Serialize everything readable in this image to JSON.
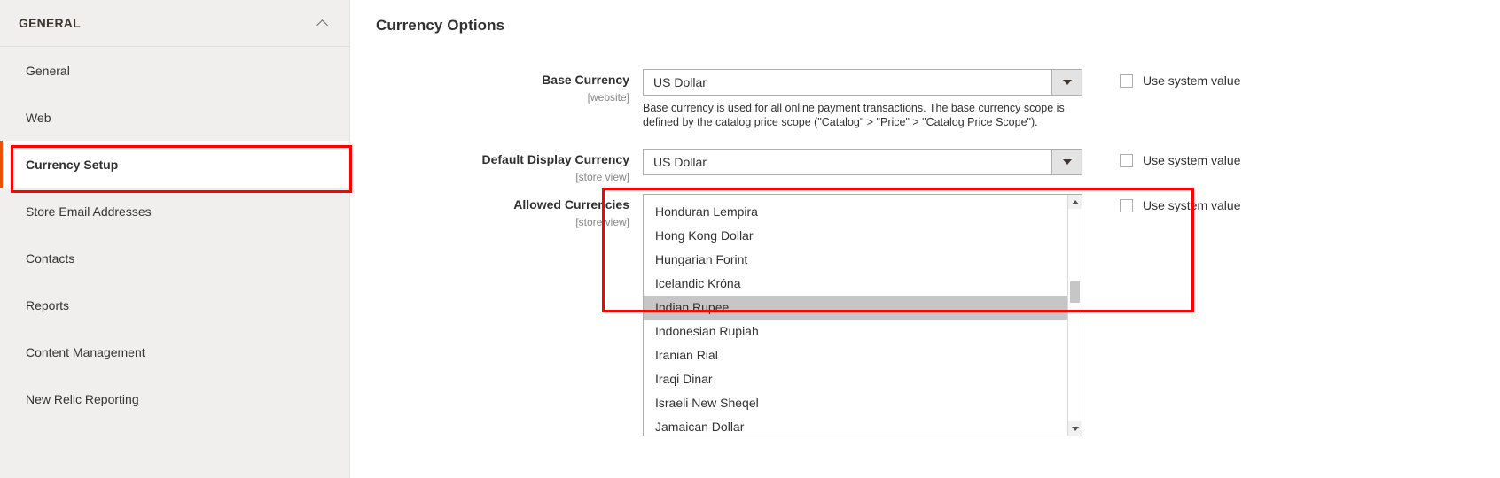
{
  "sidebar": {
    "header": {
      "title": "GENERAL",
      "collapse_icon": "chevron-up-icon"
    },
    "items": [
      {
        "label": "General",
        "active": false
      },
      {
        "label": "Web",
        "active": false
      },
      {
        "label": "Currency Setup",
        "active": true
      },
      {
        "label": "Store Email Addresses",
        "active": false
      },
      {
        "label": "Contacts",
        "active": false
      },
      {
        "label": "Reports",
        "active": false
      },
      {
        "label": "Content Management",
        "active": false
      },
      {
        "label": "New Relic Reporting",
        "active": false
      }
    ]
  },
  "main": {
    "page_title": "Currency Options",
    "fields": {
      "base_currency": {
        "label": "Base Currency",
        "scope": "[website]",
        "value": "US Dollar",
        "note": "Base currency is used for all online payment transactions. The base currency scope is defined by the catalog price scope (\"Catalog\" > \"Price\" > \"Catalog Price Scope\").",
        "use_system_value_label": "Use system value",
        "use_system_value_checked": false
      },
      "default_display_currency": {
        "label": "Default Display Currency",
        "scope": "[store view]",
        "value": "US Dollar",
        "use_system_value_label": "Use system value",
        "use_system_value_checked": false
      },
      "allowed_currencies": {
        "label": "Allowed Currencies",
        "scope": "[store view]",
        "use_system_value_label": "Use system value",
        "use_system_value_checked": false,
        "options": [
          {
            "label": "Honduran Lempira",
            "selected": false
          },
          {
            "label": "Hong Kong Dollar",
            "selected": false
          },
          {
            "label": "Hungarian Forint",
            "selected": false
          },
          {
            "label": "Icelandic Króna",
            "selected": false
          },
          {
            "label": "Indian Rupee",
            "selected": true
          },
          {
            "label": "Indonesian Rupiah",
            "selected": false
          },
          {
            "label": "Iranian Rial",
            "selected": false
          },
          {
            "label": "Iraqi Dinar",
            "selected": false
          },
          {
            "label": "Israeli New Sheqel",
            "selected": false
          },
          {
            "label": "Jamaican Dollar",
            "selected": false
          }
        ],
        "scrollbar": {
          "up_icon": "triangle-up-icon",
          "down_icon": "triangle-down-icon"
        }
      }
    }
  },
  "annotations": {
    "highlight_color": "#ff0000",
    "boxes": [
      {
        "name": "currency-setup-sidebar-highlight"
      },
      {
        "name": "allowed-currencies-highlight"
      }
    ]
  },
  "colors": {
    "accent": "#eb5202",
    "sidebar_bg": "#f0efee",
    "selected_option_bg": "#c6c6c6"
  }
}
